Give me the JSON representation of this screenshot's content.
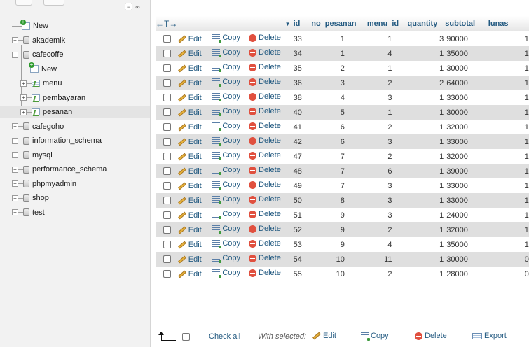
{
  "nav": {
    "items": [
      {
        "label": "New",
        "type": "new",
        "level": 0
      },
      {
        "label": "akademik",
        "type": "db",
        "level": 0
      },
      {
        "label": "cafecoffe",
        "type": "db",
        "level": 0,
        "expanded": true
      },
      {
        "label": "New",
        "type": "new",
        "level": 1
      },
      {
        "label": "menu",
        "type": "table",
        "level": 1
      },
      {
        "label": "pembayaran",
        "type": "table",
        "level": 1
      },
      {
        "label": "pesanan",
        "type": "table",
        "level": 1,
        "selected": true
      },
      {
        "label": "cafegoho",
        "type": "db",
        "level": 0
      },
      {
        "label": "information_schema",
        "type": "db",
        "level": 0
      },
      {
        "label": "mysql",
        "type": "db",
        "level": 0
      },
      {
        "label": "performance_schema",
        "type": "db",
        "level": 0
      },
      {
        "label": "phpmyadmin",
        "type": "db",
        "level": 0
      },
      {
        "label": "shop",
        "type": "db",
        "level": 0
      },
      {
        "label": "test",
        "type": "db",
        "level": 0
      }
    ]
  },
  "table": {
    "arrows_label": "←T→",
    "columns": [
      "id",
      "no_pesanan",
      "menu_id",
      "quantity",
      "subtotal",
      "lunas"
    ],
    "action_labels": {
      "edit": "Edit",
      "copy": "Copy",
      "delete": "Delete"
    },
    "rows": [
      {
        "id": "33",
        "no_pesanan": "1",
        "menu_id": "1",
        "quantity": "3",
        "subtotal": "90000",
        "lunas": "1"
      },
      {
        "id": "34",
        "no_pesanan": "1",
        "menu_id": "4",
        "quantity": "1",
        "subtotal": "35000",
        "lunas": "1"
      },
      {
        "id": "35",
        "no_pesanan": "2",
        "menu_id": "1",
        "quantity": "1",
        "subtotal": "30000",
        "lunas": "1"
      },
      {
        "id": "36",
        "no_pesanan": "3",
        "menu_id": "2",
        "quantity": "2",
        "subtotal": "64000",
        "lunas": "1"
      },
      {
        "id": "38",
        "no_pesanan": "4",
        "menu_id": "3",
        "quantity": "1",
        "subtotal": "33000",
        "lunas": "1"
      },
      {
        "id": "40",
        "no_pesanan": "5",
        "menu_id": "1",
        "quantity": "1",
        "subtotal": "30000",
        "lunas": "1"
      },
      {
        "id": "41",
        "no_pesanan": "6",
        "menu_id": "2",
        "quantity": "1",
        "subtotal": "32000",
        "lunas": "1"
      },
      {
        "id": "42",
        "no_pesanan": "6",
        "menu_id": "3",
        "quantity": "1",
        "subtotal": "33000",
        "lunas": "1"
      },
      {
        "id": "47",
        "no_pesanan": "7",
        "menu_id": "2",
        "quantity": "1",
        "subtotal": "32000",
        "lunas": "1"
      },
      {
        "id": "48",
        "no_pesanan": "7",
        "menu_id": "6",
        "quantity": "1",
        "subtotal": "39000",
        "lunas": "1"
      },
      {
        "id": "49",
        "no_pesanan": "7",
        "menu_id": "3",
        "quantity": "1",
        "subtotal": "33000",
        "lunas": "1"
      },
      {
        "id": "50",
        "no_pesanan": "8",
        "menu_id": "3",
        "quantity": "1",
        "subtotal": "33000",
        "lunas": "1"
      },
      {
        "id": "51",
        "no_pesanan": "9",
        "menu_id": "3",
        "quantity": "1",
        "subtotal": "24000",
        "lunas": "1"
      },
      {
        "id": "52",
        "no_pesanan": "9",
        "menu_id": "2",
        "quantity": "1",
        "subtotal": "32000",
        "lunas": "1"
      },
      {
        "id": "53",
        "no_pesanan": "9",
        "menu_id": "4",
        "quantity": "1",
        "subtotal": "35000",
        "lunas": "1"
      },
      {
        "id": "54",
        "no_pesanan": "10",
        "menu_id": "11",
        "quantity": "1",
        "subtotal": "30000",
        "lunas": "0"
      },
      {
        "id": "55",
        "no_pesanan": "10",
        "menu_id": "2",
        "quantity": "1",
        "subtotal": "28000",
        "lunas": "0"
      }
    ]
  },
  "bottom": {
    "check_all": "Check all",
    "with_selected": "With selected:",
    "edit": "Edit",
    "copy": "Copy",
    "delete": "Delete",
    "export": "Export"
  },
  "colors": {
    "link": "#235a81",
    "row_alt": "#dfdfdf",
    "nav_bg": "#f2f2f2"
  }
}
